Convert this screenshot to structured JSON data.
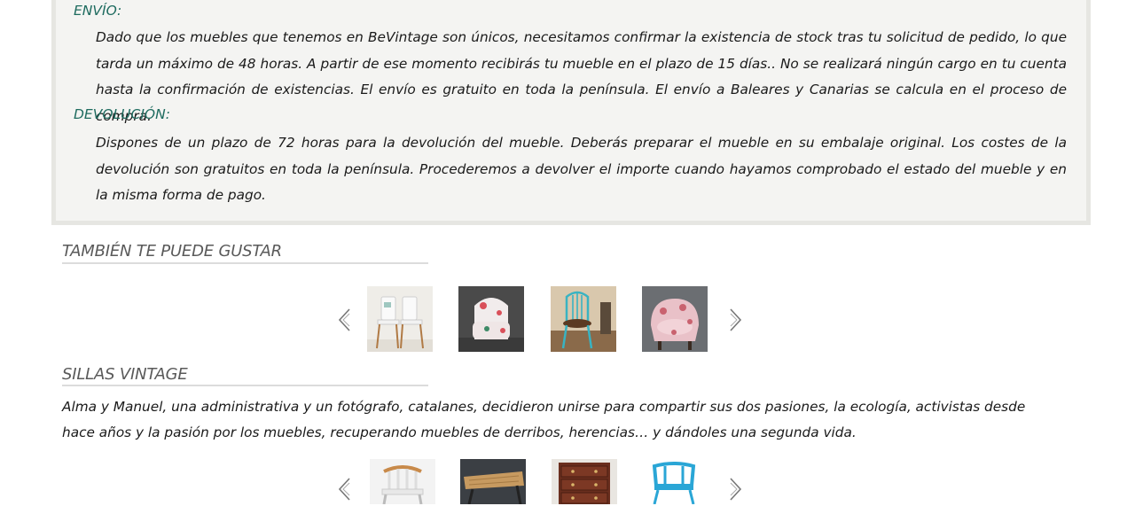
{
  "info": {
    "shipping_heading": "ENVÍO:",
    "shipping_text": "Dado que los muebles que tenemos en BeVintage son únicos, necesitamos confirmar la existencia de stock tras tu solicitud de pedido, lo que tarda un máximo de 48 horas. A partir de ese momento recibirás tu mueble en el plazo de 15 días.. No se realizará ningún cargo en tu cuenta hasta la confirmación de existencias. El envío es gratuito en toda la península. El envío a Baleares y Canarias se calcula en el proceso de compra.",
    "return_heading": "DEVOLUCIÓN:",
    "return_text": "Dispones de un plazo de 72 horas para la devolución del mueble. Deberás preparar el mueble en su embalaje original. Los costes de la devolución son gratuitos en toda la península. Procederemos a devolver el importe cuando hayamos comprobado el estado del mueble y en la misma forma de pago."
  },
  "related": {
    "title": "TAMBIÉN TE PUEDE GUSTAR",
    "prev_icon": "chevron-left-icon",
    "next_icon": "chevron-right-icon",
    "items": [
      {
        "icon": "white-chairs-pair-photo"
      },
      {
        "icon": "floral-armchair-photo"
      },
      {
        "icon": "turquoise-windsor-chair-photo"
      },
      {
        "icon": "pink-tub-chair-photo"
      }
    ]
  },
  "vintage": {
    "title": "SILLAS VINTAGE",
    "description": "Alma y Manuel, una administrativa y un fotógrafo, catalanes, decidieron unirse para compartir sus dos pasiones, la ecología, activistas desde hace años y la pasión por los muebles, recuperando muebles de derribos, herencias… y dándoles una segunda vida.",
    "prev_icon": "chevron-left-icon",
    "next_icon": "chevron-right-icon",
    "items": [
      {
        "icon": "white-spindle-chair-photo"
      },
      {
        "icon": "wooden-table-photo"
      },
      {
        "icon": "chest-of-drawers-photo"
      },
      {
        "icon": "blue-metal-chair-photo"
      }
    ]
  },
  "colors": {
    "heading_teal": "#1e6b5f",
    "box_background": "#f4f4f2",
    "section_title_grey": "#5a5a5a"
  }
}
